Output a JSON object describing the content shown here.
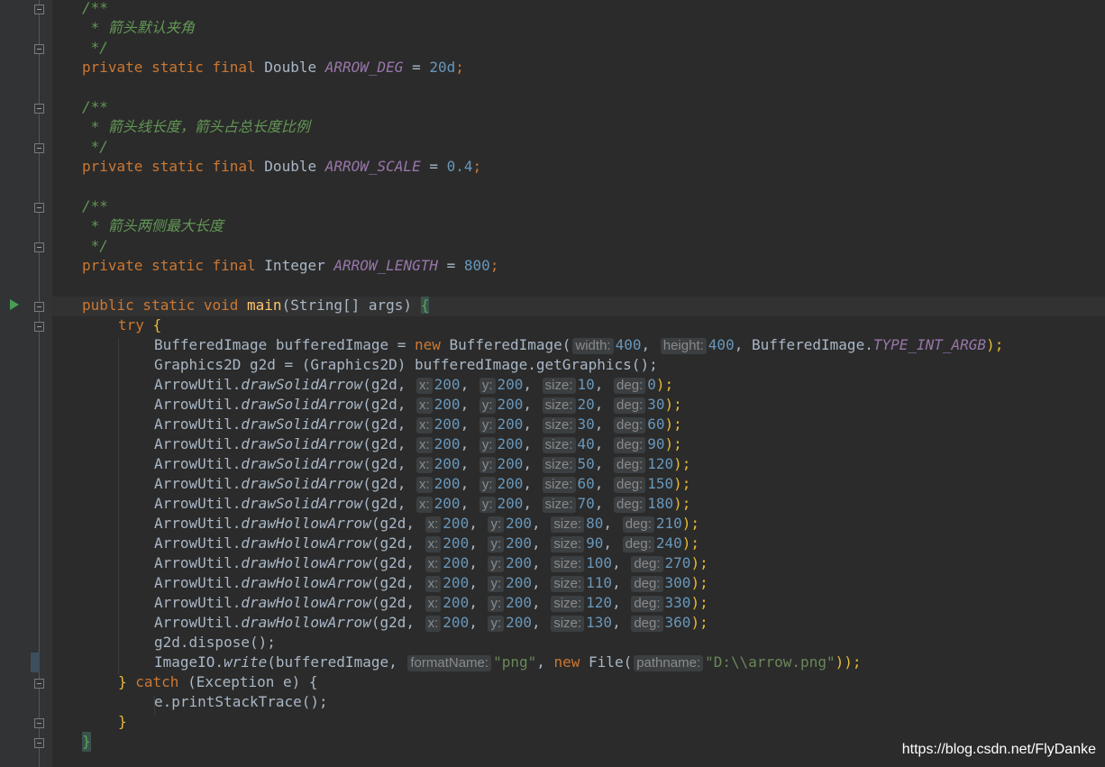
{
  "comments": {
    "open": "/**",
    "close": " */",
    "deg": " * 箭头默认夹角",
    "scale": " * 箭头线长度，箭头占总长度比例",
    "length": " * 箭头两侧最大长度"
  },
  "fields": {
    "prefix": "private static final ",
    "deg": {
      "type": "Double",
      "name": "ARROW_DEG",
      "value": "20d"
    },
    "scale": {
      "type": "Double",
      "name": "ARROW_SCALE",
      "value": "0.4"
    },
    "length": {
      "type": "Integer",
      "name": "ARROW_LENGTH",
      "value": "800"
    }
  },
  "main_signature": {
    "mods": "public static void ",
    "name": "main",
    "params": "(String[] args) "
  },
  "try_kw": "try",
  "buffered": {
    "decl": "BufferedImage bufferedImage = ",
    "new_kw": "new",
    "ctor": " BufferedImage(",
    "hint_w": "width:",
    "w": "400",
    "hint_h": "height:",
    "h": "400",
    "cls": ", BufferedImage.",
    "const": "TYPE_INT_ARGB",
    "end": ");"
  },
  "graphics_line": "Graphics2D g2d = (Graphics2D) bufferedImage.getGraphics();",
  "arrow_calls": [
    {
      "method": "drawSolidArrow",
      "x": "200",
      "y": "200",
      "size": "10",
      "deg": "0"
    },
    {
      "method": "drawSolidArrow",
      "x": "200",
      "y": "200",
      "size": "20",
      "deg": "30"
    },
    {
      "method": "drawSolidArrow",
      "x": "200",
      "y": "200",
      "size": "30",
      "deg": "60"
    },
    {
      "method": "drawSolidArrow",
      "x": "200",
      "y": "200",
      "size": "40",
      "deg": "90"
    },
    {
      "method": "drawSolidArrow",
      "x": "200",
      "y": "200",
      "size": "50",
      "deg": "120"
    },
    {
      "method": "drawSolidArrow",
      "x": "200",
      "y": "200",
      "size": "60",
      "deg": "150"
    },
    {
      "method": "drawSolidArrow",
      "x": "200",
      "y": "200",
      "size": "70",
      "deg": "180"
    },
    {
      "method": "drawHollowArrow",
      "x": "200",
      "y": "200",
      "size": "80",
      "deg": "210"
    },
    {
      "method": "drawHollowArrow",
      "x": "200",
      "y": "200",
      "size": "90",
      "deg": "240"
    },
    {
      "method": "drawHollowArrow",
      "x": "200",
      "y": "200",
      "size": "100",
      "deg": "270"
    },
    {
      "method": "drawHollowArrow",
      "x": "200",
      "y": "200",
      "size": "110",
      "deg": "300"
    },
    {
      "method": "drawHollowArrow",
      "x": "200",
      "y": "200",
      "size": "120",
      "deg": "330"
    },
    {
      "method": "drawHollowArrow",
      "x": "200",
      "y": "200",
      "size": "130",
      "deg": "360"
    }
  ],
  "arrow_call_parts": {
    "cls": "ArrowUtil.",
    "open": "(g2d, ",
    "hint_x": "x:",
    "hint_y": "y:",
    "hint_size": "size:",
    "hint_deg": "deg:",
    "end": ");"
  },
  "dispose_line": "g2d.dispose();",
  "write": {
    "cls": "ImageIO.",
    "method": "write",
    "open": "(bufferedImage, ",
    "hint_fmt": "formatName:",
    "fmt": "\"png\"",
    "new_kw": "new",
    "file": " File(",
    "hint_path": "pathname:",
    "path": "\"D:\\\\arrow.png\"",
    "end": "));"
  },
  "catch_line": {
    "close": "} ",
    "kw": "catch",
    "rest": " (Exception e) {"
  },
  "print_line": "e.printStackTrace();",
  "close_brace": "}",
  "watermark": "https://blog.csdn.net/FlyDanke"
}
